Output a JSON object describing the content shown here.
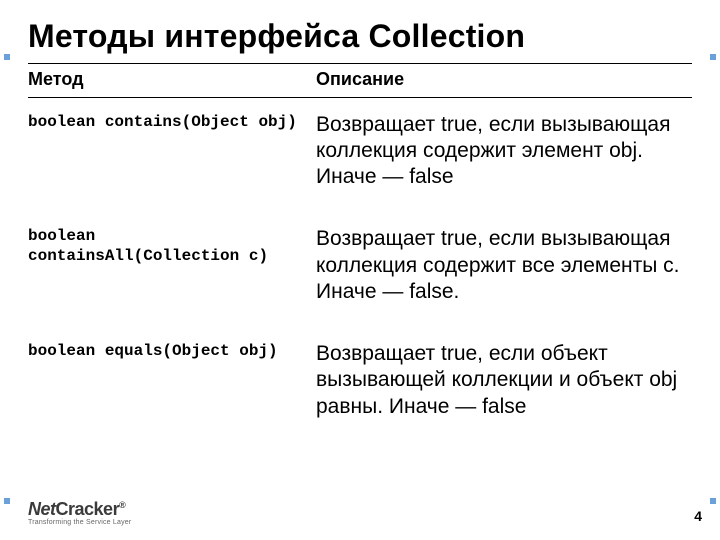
{
  "title": "Методы интерфейса Collection",
  "table": {
    "headers": {
      "method": "Метод",
      "description": "Описание"
    },
    "rows": [
      {
        "method": "boolean contains(Object obj)",
        "description": "Возвращает true, если вызывающая коллекция содержит элемент obj. Иначе — false"
      },
      {
        "method": "boolean\ncontainsAll(Collection c)",
        "description": "Возвращает true, если вызывающая коллекция содержит все элементы c. Иначе — false."
      },
      {
        "method": "boolean equals(Object obj)",
        "description": "Возвращает true, если объект вызывающей коллекции и объект obj равны. Иначе — false"
      }
    ]
  },
  "logo": {
    "brand_prefix": "Net",
    "brand_suffix": "Cracker",
    "registered": "®",
    "tagline": "Transforming the Service Layer"
  },
  "page_number": "4"
}
